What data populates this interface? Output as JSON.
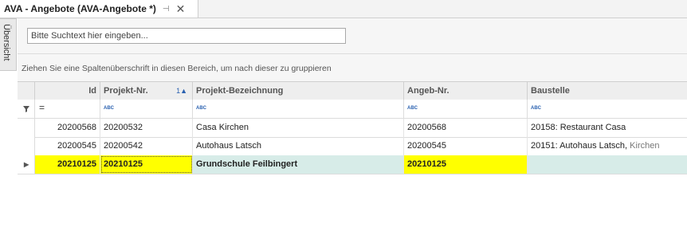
{
  "tab": {
    "title": "AVA - Angebote (AVA-Angebote *)",
    "pin_icon": "pin-icon",
    "close_glyph": "✕"
  },
  "sidebar": {
    "overview_label": "Übersicht"
  },
  "search": {
    "placeholder": "Bitte Suchtext hier eingeben..."
  },
  "grouping": {
    "hint": "Ziehen Sie eine Spaltenüberschrift in diesen Bereich, um nach dieser zu gruppieren"
  },
  "grid": {
    "columns": [
      {
        "label": "Id"
      },
      {
        "label": "Projekt-Nr.",
        "sort_index": "1",
        "sort": "ascending"
      },
      {
        "label": "Projekt-Bezeichnung"
      },
      {
        "label": "Angeb-Nr."
      },
      {
        "label": "Baustelle"
      }
    ],
    "filter_row": {
      "id_operator": "=",
      "text_operator": "ABC"
    },
    "rows": [
      {
        "id": "20200568",
        "projekt_nr": "20200532",
        "bezeichnung": "Casa Kirchen",
        "angeb_nr": "20200568",
        "baustelle": "20158: Restaurant Casa",
        "baustelle_extra": ""
      },
      {
        "id": "20200545",
        "projekt_nr": "20200542",
        "bezeichnung": "Autohaus Latsch",
        "angeb_nr": "20200545",
        "baustelle": "20151: Autohaus Latsch,",
        "baustelle_extra": "Kirchen"
      },
      {
        "id": "20210125",
        "projekt_nr": "20210125",
        "bezeichnung": "Grundschule Feilbingert",
        "angeb_nr": "20210125",
        "baustelle": "",
        "baustelle_extra": "",
        "selected": true
      }
    ]
  },
  "colors": {
    "highlight": "#ffff00",
    "selected_row": "#d7ece8",
    "header_bg": "#eeeeee"
  }
}
